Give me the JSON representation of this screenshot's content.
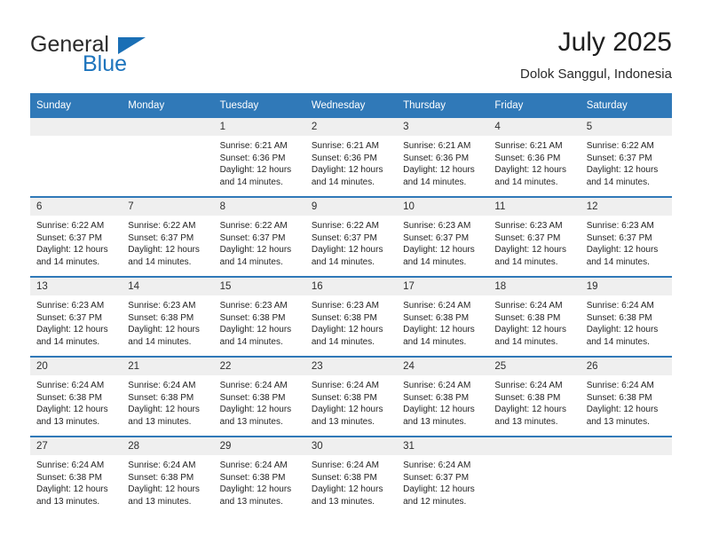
{
  "brand": {
    "name_part1": "General",
    "name_part2": "Blue",
    "accent_color": "#1a6fb5"
  },
  "header": {
    "title": "July 2025",
    "subtitle": "Dolok Sanggul, Indonesia"
  },
  "calendar": {
    "header_color": "#3079b8",
    "daynum_band_color": "#efefef",
    "weekdays": [
      "Sunday",
      "Monday",
      "Tuesday",
      "Wednesday",
      "Thursday",
      "Friday",
      "Saturday"
    ],
    "weeks": [
      [
        {
          "day": "",
          "sunrise": "",
          "sunset": "",
          "daylight1": "",
          "daylight2": ""
        },
        {
          "day": "",
          "sunrise": "",
          "sunset": "",
          "daylight1": "",
          "daylight2": ""
        },
        {
          "day": "1",
          "sunrise": "Sunrise: 6:21 AM",
          "sunset": "Sunset: 6:36 PM",
          "daylight1": "Daylight: 12 hours",
          "daylight2": "and 14 minutes."
        },
        {
          "day": "2",
          "sunrise": "Sunrise: 6:21 AM",
          "sunset": "Sunset: 6:36 PM",
          "daylight1": "Daylight: 12 hours",
          "daylight2": "and 14 minutes."
        },
        {
          "day": "3",
          "sunrise": "Sunrise: 6:21 AM",
          "sunset": "Sunset: 6:36 PM",
          "daylight1": "Daylight: 12 hours",
          "daylight2": "and 14 minutes."
        },
        {
          "day": "4",
          "sunrise": "Sunrise: 6:21 AM",
          "sunset": "Sunset: 6:36 PM",
          "daylight1": "Daylight: 12 hours",
          "daylight2": "and 14 minutes."
        },
        {
          "day": "5",
          "sunrise": "Sunrise: 6:22 AM",
          "sunset": "Sunset: 6:37 PM",
          "daylight1": "Daylight: 12 hours",
          "daylight2": "and 14 minutes."
        }
      ],
      [
        {
          "day": "6",
          "sunrise": "Sunrise: 6:22 AM",
          "sunset": "Sunset: 6:37 PM",
          "daylight1": "Daylight: 12 hours",
          "daylight2": "and 14 minutes."
        },
        {
          "day": "7",
          "sunrise": "Sunrise: 6:22 AM",
          "sunset": "Sunset: 6:37 PM",
          "daylight1": "Daylight: 12 hours",
          "daylight2": "and 14 minutes."
        },
        {
          "day": "8",
          "sunrise": "Sunrise: 6:22 AM",
          "sunset": "Sunset: 6:37 PM",
          "daylight1": "Daylight: 12 hours",
          "daylight2": "and 14 minutes."
        },
        {
          "day": "9",
          "sunrise": "Sunrise: 6:22 AM",
          "sunset": "Sunset: 6:37 PM",
          "daylight1": "Daylight: 12 hours",
          "daylight2": "and 14 minutes."
        },
        {
          "day": "10",
          "sunrise": "Sunrise: 6:23 AM",
          "sunset": "Sunset: 6:37 PM",
          "daylight1": "Daylight: 12 hours",
          "daylight2": "and 14 minutes."
        },
        {
          "day": "11",
          "sunrise": "Sunrise: 6:23 AM",
          "sunset": "Sunset: 6:37 PM",
          "daylight1": "Daylight: 12 hours",
          "daylight2": "and 14 minutes."
        },
        {
          "day": "12",
          "sunrise": "Sunrise: 6:23 AM",
          "sunset": "Sunset: 6:37 PM",
          "daylight1": "Daylight: 12 hours",
          "daylight2": "and 14 minutes."
        }
      ],
      [
        {
          "day": "13",
          "sunrise": "Sunrise: 6:23 AM",
          "sunset": "Sunset: 6:37 PM",
          "daylight1": "Daylight: 12 hours",
          "daylight2": "and 14 minutes."
        },
        {
          "day": "14",
          "sunrise": "Sunrise: 6:23 AM",
          "sunset": "Sunset: 6:38 PM",
          "daylight1": "Daylight: 12 hours",
          "daylight2": "and 14 minutes."
        },
        {
          "day": "15",
          "sunrise": "Sunrise: 6:23 AM",
          "sunset": "Sunset: 6:38 PM",
          "daylight1": "Daylight: 12 hours",
          "daylight2": "and 14 minutes."
        },
        {
          "day": "16",
          "sunrise": "Sunrise: 6:23 AM",
          "sunset": "Sunset: 6:38 PM",
          "daylight1": "Daylight: 12 hours",
          "daylight2": "and 14 minutes."
        },
        {
          "day": "17",
          "sunrise": "Sunrise: 6:24 AM",
          "sunset": "Sunset: 6:38 PM",
          "daylight1": "Daylight: 12 hours",
          "daylight2": "and 14 minutes."
        },
        {
          "day": "18",
          "sunrise": "Sunrise: 6:24 AM",
          "sunset": "Sunset: 6:38 PM",
          "daylight1": "Daylight: 12 hours",
          "daylight2": "and 14 minutes."
        },
        {
          "day": "19",
          "sunrise": "Sunrise: 6:24 AM",
          "sunset": "Sunset: 6:38 PM",
          "daylight1": "Daylight: 12 hours",
          "daylight2": "and 14 minutes."
        }
      ],
      [
        {
          "day": "20",
          "sunrise": "Sunrise: 6:24 AM",
          "sunset": "Sunset: 6:38 PM",
          "daylight1": "Daylight: 12 hours",
          "daylight2": "and 13 minutes."
        },
        {
          "day": "21",
          "sunrise": "Sunrise: 6:24 AM",
          "sunset": "Sunset: 6:38 PM",
          "daylight1": "Daylight: 12 hours",
          "daylight2": "and 13 minutes."
        },
        {
          "day": "22",
          "sunrise": "Sunrise: 6:24 AM",
          "sunset": "Sunset: 6:38 PM",
          "daylight1": "Daylight: 12 hours",
          "daylight2": "and 13 minutes."
        },
        {
          "day": "23",
          "sunrise": "Sunrise: 6:24 AM",
          "sunset": "Sunset: 6:38 PM",
          "daylight1": "Daylight: 12 hours",
          "daylight2": "and 13 minutes."
        },
        {
          "day": "24",
          "sunrise": "Sunrise: 6:24 AM",
          "sunset": "Sunset: 6:38 PM",
          "daylight1": "Daylight: 12 hours",
          "daylight2": "and 13 minutes."
        },
        {
          "day": "25",
          "sunrise": "Sunrise: 6:24 AM",
          "sunset": "Sunset: 6:38 PM",
          "daylight1": "Daylight: 12 hours",
          "daylight2": "and 13 minutes."
        },
        {
          "day": "26",
          "sunrise": "Sunrise: 6:24 AM",
          "sunset": "Sunset: 6:38 PM",
          "daylight1": "Daylight: 12 hours",
          "daylight2": "and 13 minutes."
        }
      ],
      [
        {
          "day": "27",
          "sunrise": "Sunrise: 6:24 AM",
          "sunset": "Sunset: 6:38 PM",
          "daylight1": "Daylight: 12 hours",
          "daylight2": "and 13 minutes."
        },
        {
          "day": "28",
          "sunrise": "Sunrise: 6:24 AM",
          "sunset": "Sunset: 6:38 PM",
          "daylight1": "Daylight: 12 hours",
          "daylight2": "and 13 minutes."
        },
        {
          "day": "29",
          "sunrise": "Sunrise: 6:24 AM",
          "sunset": "Sunset: 6:38 PM",
          "daylight1": "Daylight: 12 hours",
          "daylight2": "and 13 minutes."
        },
        {
          "day": "30",
          "sunrise": "Sunrise: 6:24 AM",
          "sunset": "Sunset: 6:38 PM",
          "daylight1": "Daylight: 12 hours",
          "daylight2": "and 13 minutes."
        },
        {
          "day": "31",
          "sunrise": "Sunrise: 6:24 AM",
          "sunset": "Sunset: 6:37 PM",
          "daylight1": "Daylight: 12 hours",
          "daylight2": "and 12 minutes."
        },
        {
          "day": "",
          "sunrise": "",
          "sunset": "",
          "daylight1": "",
          "daylight2": ""
        },
        {
          "day": "",
          "sunrise": "",
          "sunset": "",
          "daylight1": "",
          "daylight2": ""
        }
      ]
    ]
  }
}
